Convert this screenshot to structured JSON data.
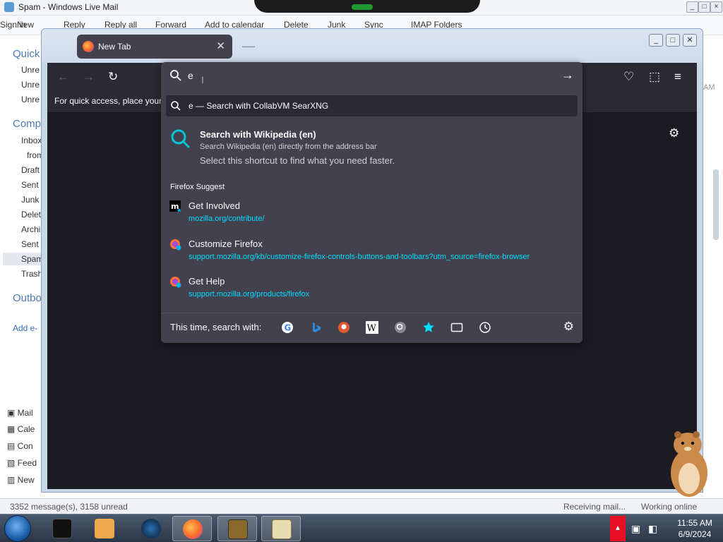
{
  "wlm": {
    "title": "Spam - Windows Live Mail",
    "sign_in": "Sign in",
    "ribbon": [
      "New",
      "Reply",
      "Reply all",
      "Forward",
      "Add to calendar",
      "Delete",
      "Junk",
      "Sync",
      "IMAP Folders"
    ],
    "sidebar": {
      "quick_heading": "Quick",
      "quick_items": [
        "Unre",
        "Unre",
        "Unre"
      ],
      "comp_heading": "Comp",
      "folders": [
        "Inbox",
        "from",
        "Draft",
        "Sent",
        "Junk",
        "Delet",
        "Archi",
        "Sent",
        "Spam",
        "Trash"
      ],
      "outbox": "Outbo",
      "add_email": "Add e-",
      "bottom_nav": [
        "Mail",
        "Cale",
        "Con",
        "Feed",
        "New"
      ]
    },
    "right_partial": "AM",
    "status": {
      "messages": "3352 message(s), 3158 unread",
      "receiving": "Receiving mail...",
      "online": "Working online"
    }
  },
  "firefox": {
    "tab_title": "New Tab",
    "bookmarks_hint": "For quick access, place your b",
    "urlbar": {
      "value": "e",
      "first_result": "e — Search with CollabVM SearXNG",
      "wiki_title": "Search with Wikipedia (en)",
      "wiki_sub": "Search Wikipedia (en) directly from the address bar",
      "wiki_hint": "Select this shortcut to find what you need faster.",
      "suggest_heading": "Firefox Suggest",
      "suggestions": [
        {
          "title": "Get Involved",
          "url": "mozilla.org/contribute/"
        },
        {
          "title": "Customize Firefox",
          "url": "support.mozilla.org/kb/customize-firefox-controls-buttons-and-toolbars?utm_source=firefox-browser"
        },
        {
          "title": "Get Help",
          "url": "support.mozilla.org/products/firefox"
        }
      ],
      "engines_label": "This time, search with:",
      "engines": [
        "google-icon",
        "bing-icon",
        "duckduckgo-icon",
        "wikipedia-icon",
        "searxng-icon",
        "bookmarks-icon",
        "tabs-icon",
        "history-icon"
      ]
    }
  },
  "taskbar": {
    "clock_time": "11:55 AM",
    "clock_date": "6/9/2024"
  }
}
